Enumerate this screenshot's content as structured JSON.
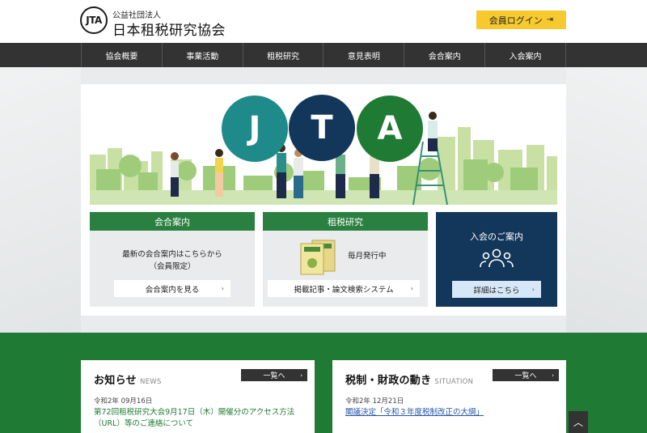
{
  "header": {
    "logo_mark": "JTA",
    "org_type": "公益社団法人",
    "org_name": "日本租税研究協会",
    "login_label": "会員ログイン",
    "accent_color": "#f6c92f"
  },
  "nav": {
    "items": [
      {
        "label": "協会概要"
      },
      {
        "label": "事業活動"
      },
      {
        "label": "租税研究"
      },
      {
        "label": "意見表明"
      },
      {
        "label": "会合案内"
      },
      {
        "label": "入会案内"
      }
    ]
  },
  "hero": {
    "letters": [
      "J",
      "T",
      "A"
    ],
    "colors": [
      "#1f8a8a",
      "#13375a",
      "#1f7a34"
    ]
  },
  "panels": {
    "meetings": {
      "title": "会合案内",
      "text1": "最新の会合案内はこちらから",
      "text2": "（会員限定）",
      "button": "会合案内を見る"
    },
    "research": {
      "title": "租税研究",
      "text": "毎月発行中",
      "button": "掲載記事・論文検索システム"
    },
    "membership": {
      "title": "入会のご案内",
      "button": "詳細はこちら",
      "icon": "people-icon"
    }
  },
  "news": {
    "title": "お知らせ",
    "title_en": "NEWS",
    "list_label": "一覧へ",
    "date": "令和2年 09月16日",
    "headline": "第72回租税研究大会9月17日（木）開催分のアクセス方法（URL）等のご連絡について"
  },
  "situation": {
    "title": "税制・財政の動き",
    "title_en": "SITUATION",
    "list_label": "一覧へ",
    "date": "令和2年 12月21日",
    "headline": "閣議決定「令和３年度税制改正の大綱」"
  }
}
